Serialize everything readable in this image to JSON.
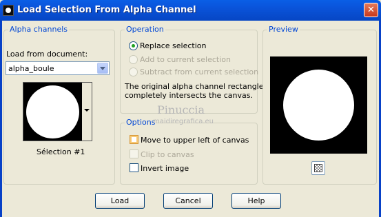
{
  "window": {
    "title": "Load Selection From Alpha Channel",
    "close_glyph": "✕"
  },
  "alpha_channels": {
    "legend": "Alpha channels",
    "load_from_label": "Load from document:",
    "document_value": "alpha_boule",
    "selection_caption": "Sélection #1"
  },
  "operation": {
    "legend": "Operation",
    "options": [
      {
        "label": "Replace selection",
        "checked": true,
        "enabled": true
      },
      {
        "label": "Add to current selection",
        "checked": false,
        "enabled": false
      },
      {
        "label": "Subtract from current selection",
        "checked": false,
        "enabled": false
      }
    ],
    "info_line1": "The original alpha channel rectangle",
    "info_line2": "completely intersects the canvas."
  },
  "options": {
    "legend": "Options",
    "checkboxes": [
      {
        "label": "Move to upper left of canvas",
        "checked": false,
        "enabled": true
      },
      {
        "label": "Clip to canvas",
        "checked": false,
        "enabled": false
      },
      {
        "label": "Invert image",
        "checked": false,
        "enabled": true
      }
    ]
  },
  "preview": {
    "legend": "Preview",
    "zoom_icon": "checkerboard-icon"
  },
  "buttons": {
    "load": "Load",
    "cancel": "Cancel",
    "help": "Help"
  },
  "watermark": {
    "name": "Pinuccia",
    "url": "maidiregrafica.eu"
  },
  "colors": {
    "titlebar": "#0A53D9",
    "dialog_bg": "#ECE9D8",
    "legend_text": "#0046D5",
    "radio_dot": "#21A121"
  }
}
